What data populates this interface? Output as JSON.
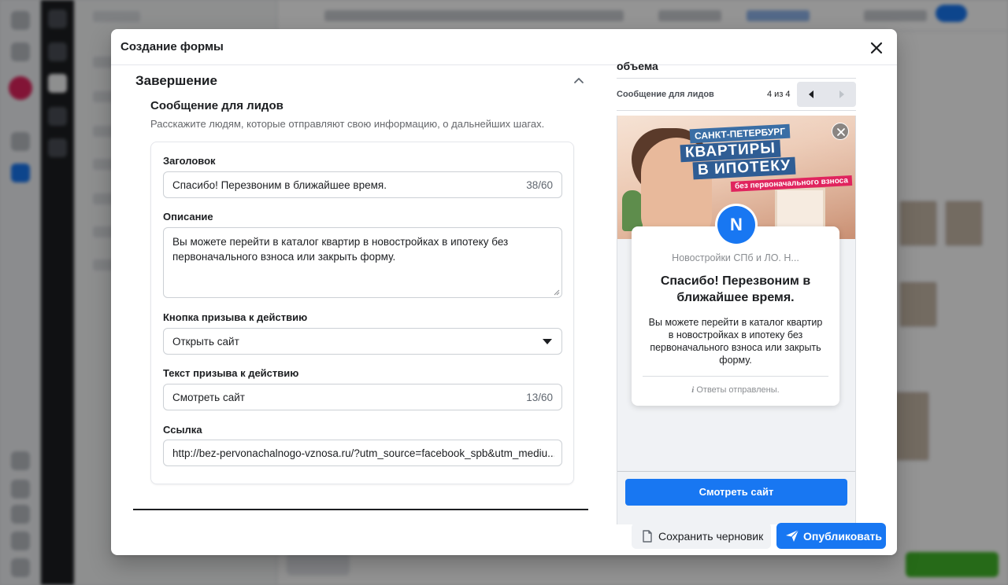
{
  "modal": {
    "title": "Создание формы",
    "section": {
      "title": "Завершение",
      "message_title": "Сообщение для лидов",
      "message_desc": "Расскажите людям, которые отправляют свою информацию, о дальнейших шагах."
    },
    "fields": {
      "headline": {
        "label": "Заголовок",
        "value": "Спасибо! Перезвоним в ближайшее время.",
        "counter": "38/60"
      },
      "description": {
        "label": "Описание",
        "value": "Вы можете перейти в каталог квартир в новостройках в ипотеку без первоначального взноса или закрыть форму."
      },
      "cta_button": {
        "label": "Кнопка призыва к действию",
        "value": "Открыть сайт"
      },
      "cta_text": {
        "label": "Текст призыва к действию",
        "value": "Смотреть сайт",
        "counter": "13/60"
      },
      "link": {
        "label": "Ссылка",
        "value": "http://bez-pervonachalnogo-vznosa.ru/?utm_source=facebook_spb&utm_mediu..."
      }
    },
    "preview": {
      "title_fragment": "объема",
      "label": "Сообщение для лидов",
      "counter": "4 из 4",
      "banner": {
        "line1": "САНКТ-ПЕТЕРБУРГ",
        "line2": "КВАРТИРЫ",
        "line3": "В ИПОТЕКУ",
        "line4": "без первоначального взноса"
      },
      "avatar_letter": "N",
      "page_name": "Новостройки СПб и ЛО. Н...",
      "headline": "Спасибо! Перезвоним в ближайшее время.",
      "description": "Вы можете перейти в каталог квартир в новостройках в ипотеку без первоначального взноса или закрыть форму.",
      "footer_note": "Ответы отправлены.",
      "cta_label": "Смотреть сайт"
    },
    "footer": {
      "draft_label": "Сохранить черновик",
      "publish_label": "Опубликовать"
    }
  },
  "colors": {
    "accent": "#1877f2",
    "text": "#1c1e21",
    "muted": "#65676b",
    "border": "#ccd0d5"
  },
  "icons": {
    "close": "close-icon",
    "collapse": "chevron-up-icon",
    "select_caret": "caret-down-icon",
    "pager_prev": "triangle-left-icon",
    "pager_next": "triangle-right-icon",
    "draft": "document-icon",
    "publish": "paper-plane-icon",
    "info": "info-icon"
  }
}
